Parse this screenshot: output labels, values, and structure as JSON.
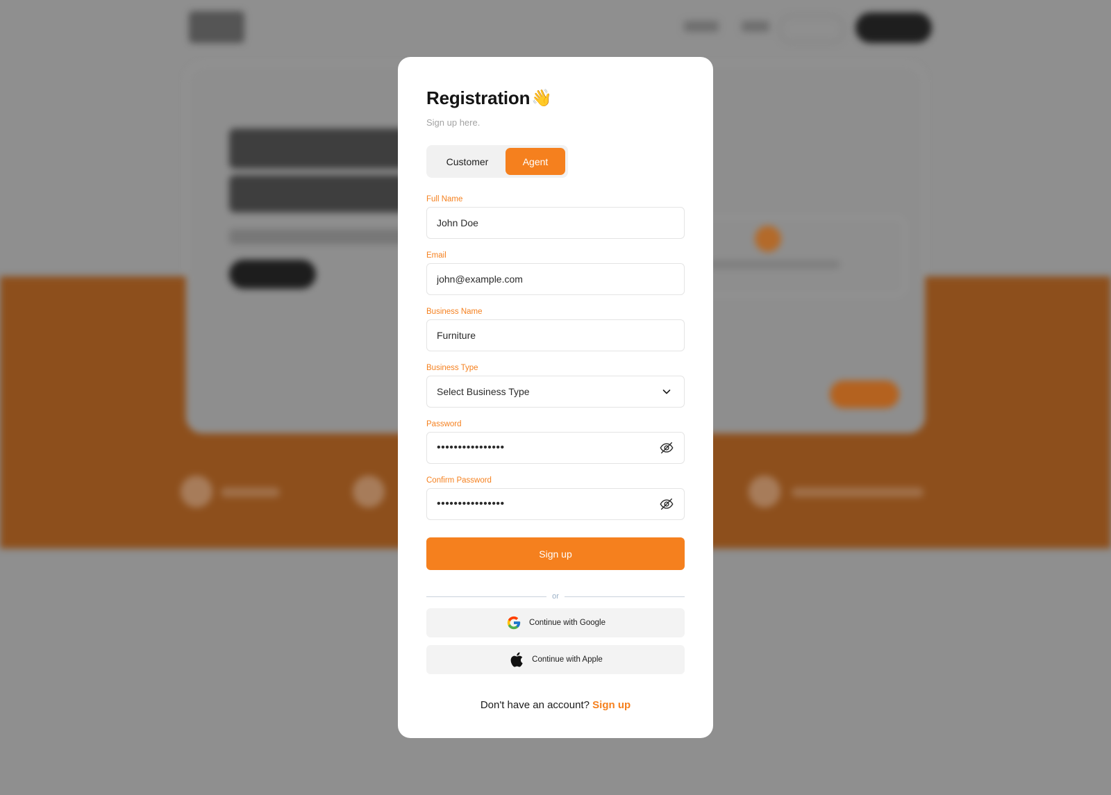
{
  "modal": {
    "title": "Registration",
    "title_emoji": "👋",
    "subtitle": "Sign up here."
  },
  "toggle": {
    "options": [
      "Customer",
      "Agent"
    ],
    "selected": "Agent"
  },
  "form": {
    "full_name": {
      "label": "Full Name",
      "value": "John Doe"
    },
    "email": {
      "label": "Email",
      "value": "john@example.com"
    },
    "business_name": {
      "label": "Business Name",
      "value": "Furniture"
    },
    "business_type": {
      "label": "Business Type",
      "value": "Select Business Type"
    },
    "password": {
      "label": "Password",
      "value": "••••••••••••••••"
    },
    "confirm_password": {
      "label": "Confirm Password",
      "value": "••••••••••••••••"
    }
  },
  "actions": {
    "signup_label": "Sign up",
    "divider_text": "or",
    "google_label": "Continue with Google",
    "apple_label": "Continue with Apple"
  },
  "footer": {
    "prompt": "Don't have an account?",
    "link": "Sign up"
  },
  "colors": {
    "accent": "#f5801e",
    "overlay": "#8f8f8f",
    "background_band": "#8d4f1c"
  },
  "icons": {
    "title": "waving-hand-icon",
    "select": "chevron-down-icon",
    "password_toggle": "eye-slash-icon",
    "google": "google-icon",
    "apple": "apple-icon"
  }
}
